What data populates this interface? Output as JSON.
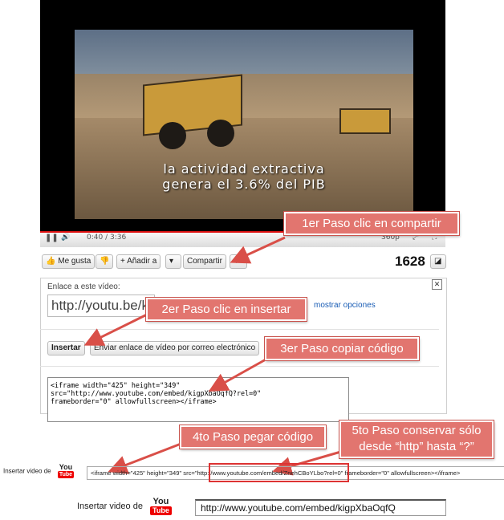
{
  "video": {
    "caption_line1": "la actividad extractiva",
    "caption_line2": "genera el 3.6% del PIB",
    "time": "0:40 / 3:36",
    "quality": "360p"
  },
  "actions": {
    "like_label": "Me gusta",
    "add_label": "Añadir a",
    "share_label": "Compartir",
    "views": "1628"
  },
  "share_panel": {
    "link_label": "Enlace a este vídeo:",
    "link_value": "http://youtu.be/kigpXbaOqfQ",
    "show_options": "mostrar opciones",
    "close": "✕",
    "embed_button": "Insertar",
    "email_button": "Enviar enlace de vídeo por correo electrónico",
    "code_line1": "<iframe width=\"425\" height=\"349\"",
    "code_line2": "src=\"http://www.youtube.com/embed/kigpXbaOqfQ?rel=0\"",
    "code_line3": "frameborder=\"0\" allowfullscreen></iframe>"
  },
  "callouts": {
    "step1": "1er Paso clic en compartir",
    "step2": "2er Paso clic en insertar",
    "step3": "3er Paso copiar código",
    "step4": "4to Paso pegar código",
    "step5_line1": "5to Paso conservar sólo",
    "step5_line2": "desde “http” hasta “?”"
  },
  "insert_section": {
    "label": "Insertar video de",
    "logo_you": "You",
    "logo_tube": "Tube",
    "embed_field_value": "<iframe width=\"425\" height=\"349\" src=\"http://www.youtube.com/embed/ZnehCBoYLbo?rel=0\" frameborder=\"0\" allowfullscreen></iframe>",
    "final_field_value": "http://www.youtube.com/embed/kigpXbaOqfQ"
  },
  "colors": {
    "callout": "#e2756f",
    "youtube_red": "#e00000",
    "highlight": "#d33333"
  }
}
